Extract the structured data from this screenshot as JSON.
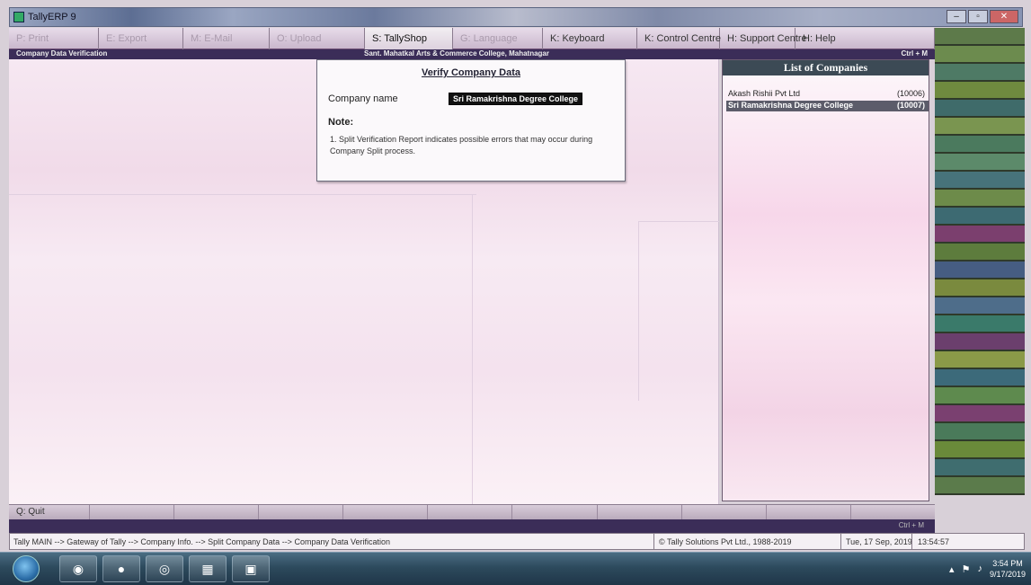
{
  "window": {
    "title": "TallyERP 9",
    "controls": [
      "–",
      "▫",
      "✕"
    ]
  },
  "buttonbar": [
    {
      "label": "P: Print",
      "faded": true
    },
    {
      "label": "E: Export",
      "faded": true
    },
    {
      "label": "M: E-Mail",
      "faded": true
    },
    {
      "label": "O: Upload",
      "faded": true
    },
    {
      "label": "S: TallyShop",
      "faded": false
    },
    {
      "label": "G: Language",
      "faded": true
    },
    {
      "label": "K: Keyboard",
      "faded": false
    },
    {
      "label": "K: Control Centre",
      "faded": false
    },
    {
      "label": "H: Support Centre",
      "faded": false
    },
    {
      "label": "H: Help",
      "faded": false
    }
  ],
  "infostrip": {
    "left": "Company Data Verification",
    "center": "Sant. Mahatkal Arts & Commerce College, Mahatnagar",
    "right": "Ctrl + M"
  },
  "dialog": {
    "title": "Verify Company Data",
    "company_label": "Company name",
    "company_value": "Sri Ramakrishna Degree College",
    "note_label": "Note:",
    "note_text": "1. Split Verification Report indicates possible errors that may occur during Company Split process."
  },
  "list_panel": {
    "title": "List of Companies",
    "companies": [
      {
        "name": "Akash Rishii Pvt Ltd",
        "number": "(10006)",
        "selected": false
      },
      {
        "name": "Sri Ramakrishna Degree College",
        "number": "(10007)",
        "selected": true
      }
    ]
  },
  "quitbar": {
    "quit_label": "Q: Quit"
  },
  "thinbar": {
    "right": "Ctrl + M"
  },
  "statusbar": {
    "path": "Tally MAIN --> Gateway of Tally --> Company Info. --> Split Company Data --> Company Data Verification",
    "copyright": "© Tally Solutions Pvt Ltd., 1988-2019",
    "date": "Tue, 17 Sep, 2019",
    "time": "13:54:57"
  },
  "taskbar": {
    "time": "3:54 PM",
    "date": "9/17/2019"
  },
  "colors": {
    "infostrip_bg": "#3b2d58",
    "list_header_bg": "#3c4a55",
    "taskbar_bg": "#2d4a5d"
  }
}
